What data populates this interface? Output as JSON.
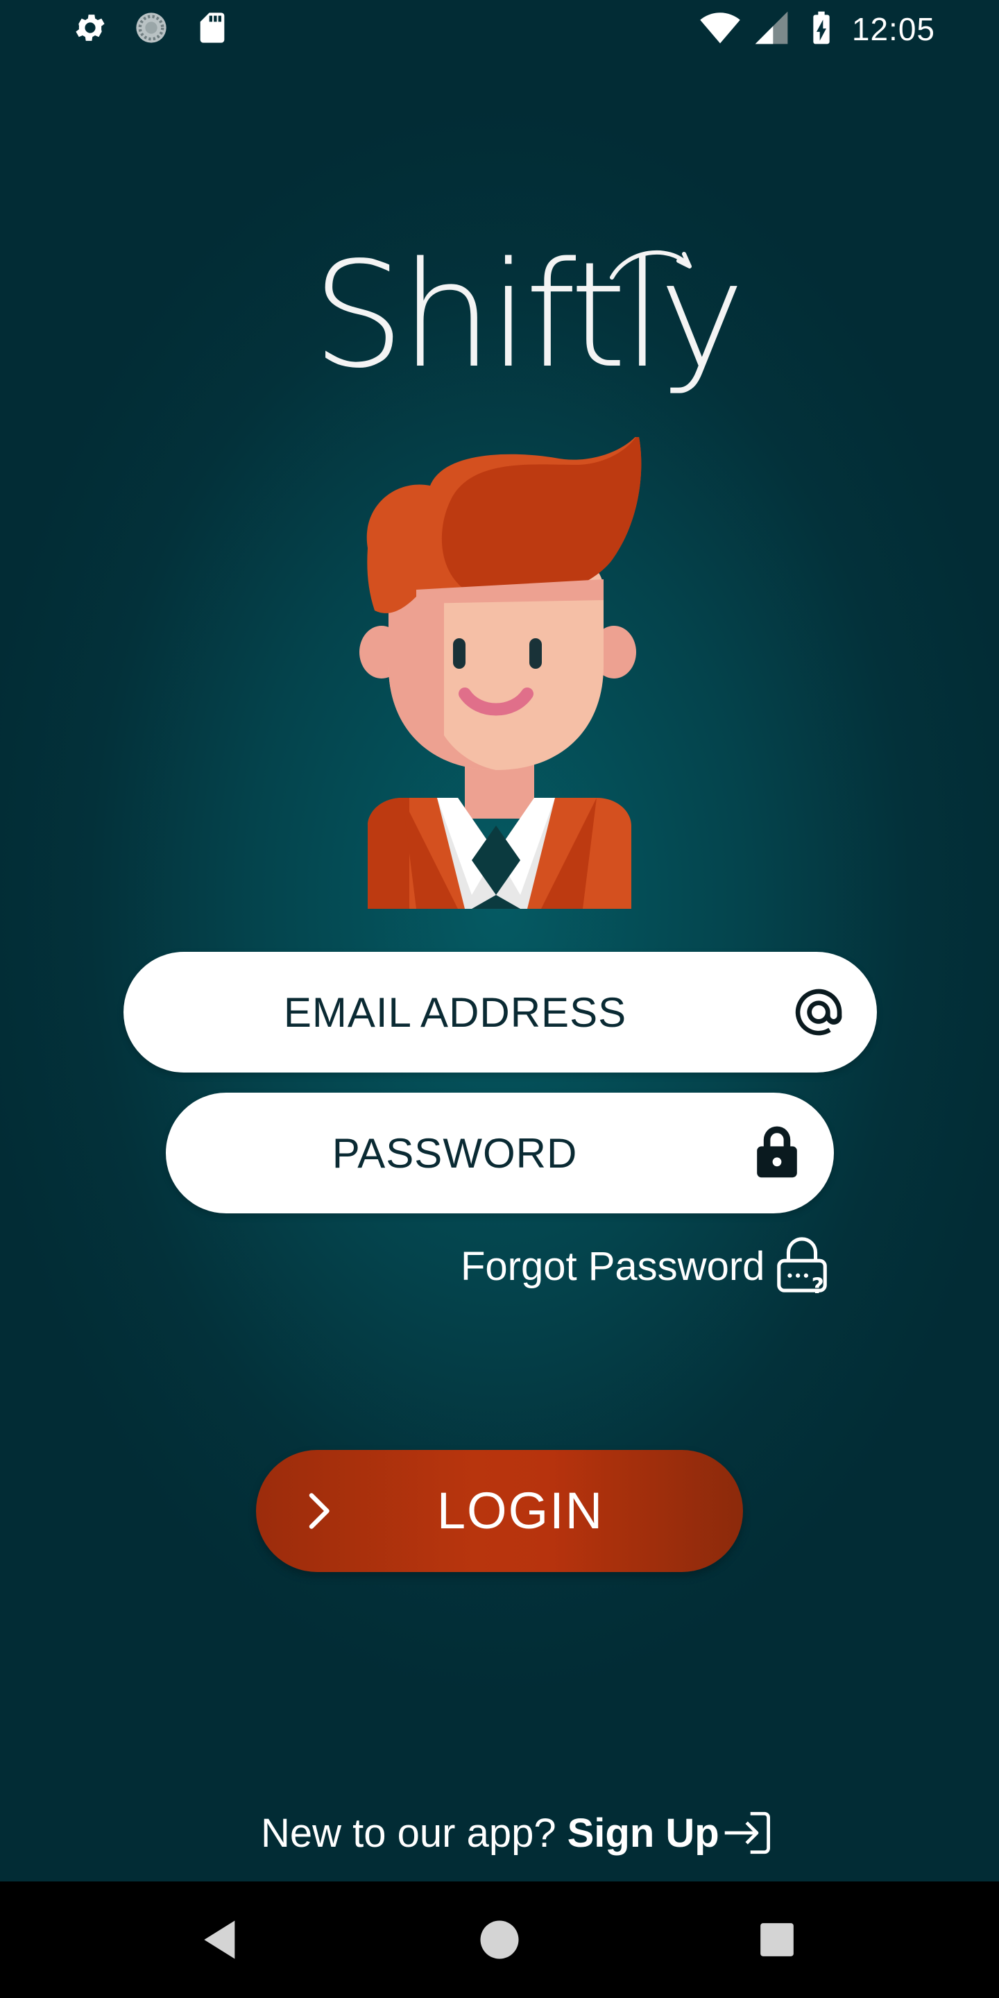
{
  "status_bar": {
    "time": "12:05",
    "left_icons": [
      "settings-icon",
      "sync-icon",
      "sd-card-icon"
    ],
    "right_icons": [
      "wifi-icon",
      "cellular-signal-icon",
      "battery-charging-icon"
    ]
  },
  "brand": {
    "logo_text": "Shiftly",
    "text_color": "#f4f4f4"
  },
  "avatar": {
    "icon": "user-avatar-illustration",
    "hair_color": "#d4501f",
    "skin_color": "#f5c0a6",
    "jacket_color": "#d4501f"
  },
  "form": {
    "email": {
      "placeholder": "EMAIL ADDRESS",
      "value": "",
      "icon": "at-sign-icon"
    },
    "password": {
      "placeholder": "PASSWORD",
      "value": "",
      "icon": "lock-icon"
    },
    "forgot_password": {
      "label": "Forgot Password",
      "icon": "forgot-password-lock-icon"
    }
  },
  "login_button": {
    "label": "LOGIN",
    "icon": "chevron-right-icon",
    "color": "#b5330d"
  },
  "signup": {
    "prompt": "New to our app?",
    "link_label": "Sign Up",
    "icon": "sign-in-arrow-icon"
  },
  "nav_bar": {
    "buttons": [
      "back-icon",
      "home-icon",
      "recents-icon"
    ]
  },
  "colors": {
    "background": "#044650",
    "background_dark": "#022c35",
    "field_background": "#ffffff",
    "field_text": "#0a2a33"
  }
}
